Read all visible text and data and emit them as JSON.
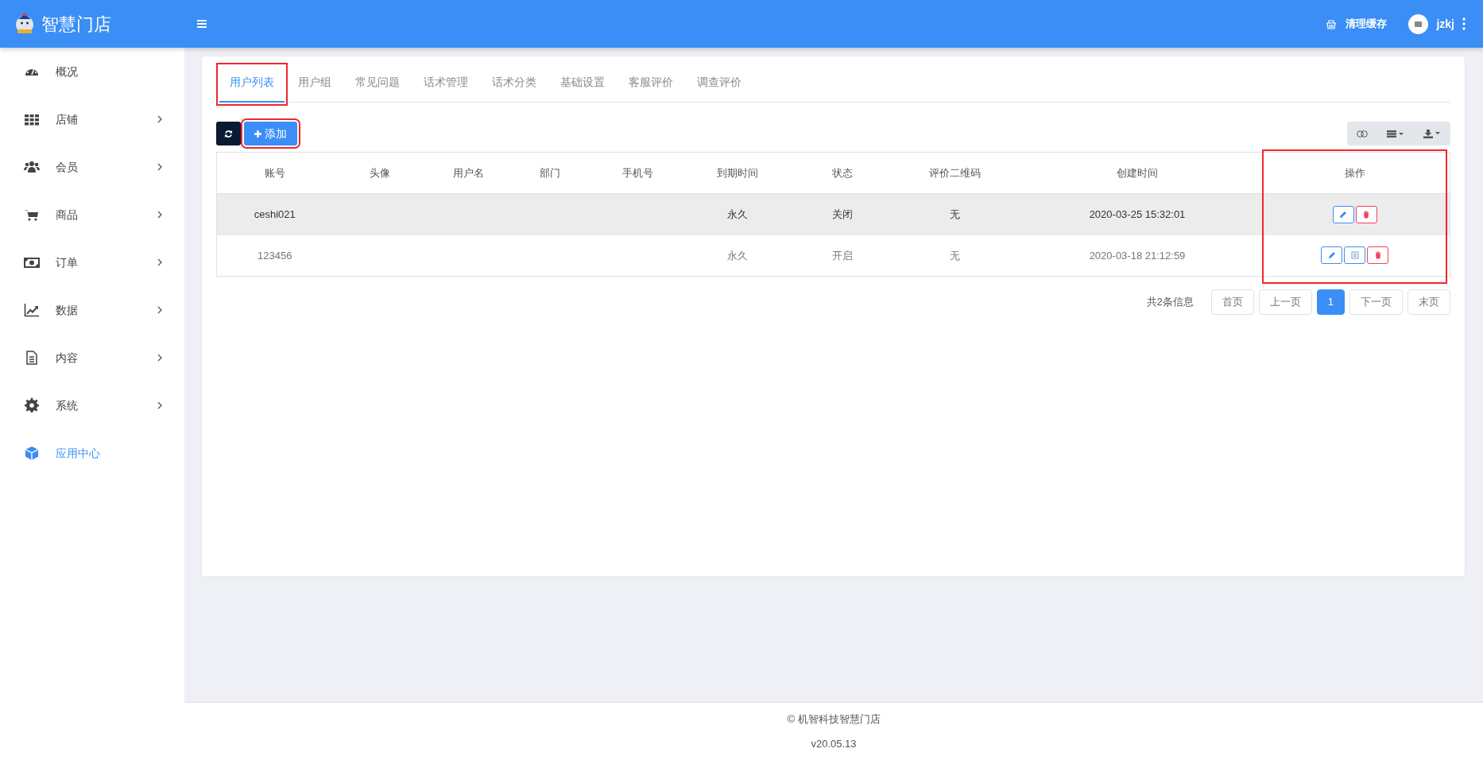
{
  "header": {
    "logo_text": "智慧门店",
    "clear_cache": "清理缓存",
    "username": "jzkj"
  },
  "sidebar": {
    "items": [
      {
        "label": "概况",
        "has_submenu": false,
        "selected": false
      },
      {
        "label": "店铺",
        "has_submenu": true,
        "selected": false
      },
      {
        "label": "会员",
        "has_submenu": true,
        "selected": false
      },
      {
        "label": "商品",
        "has_submenu": true,
        "selected": false
      },
      {
        "label": "订单",
        "has_submenu": true,
        "selected": false
      },
      {
        "label": "数据",
        "has_submenu": true,
        "selected": false
      },
      {
        "label": "内容",
        "has_submenu": true,
        "selected": false
      },
      {
        "label": "系统",
        "has_submenu": true,
        "selected": false
      },
      {
        "label": "应用中心",
        "has_submenu": false,
        "selected": true
      }
    ]
  },
  "tabs": [
    {
      "label": "用户列表",
      "selected": true,
      "highlighted": true
    },
    {
      "label": "用户组",
      "selected": false,
      "highlighted": false
    },
    {
      "label": "常见问题",
      "selected": false,
      "highlighted": false
    },
    {
      "label": "话术管理",
      "selected": false,
      "highlighted": false
    },
    {
      "label": "话术分类",
      "selected": false,
      "highlighted": false
    },
    {
      "label": "基础设置",
      "selected": false,
      "highlighted": false
    },
    {
      "label": "客服评价",
      "selected": false,
      "highlighted": false
    },
    {
      "label": "调查评价",
      "selected": false,
      "highlighted": false
    }
  ],
  "toolbar": {
    "add_label": "添加",
    "add_highlighted": true
  },
  "table": {
    "columns": [
      {
        "label": "账号",
        "highlighted": false
      },
      {
        "label": "头像",
        "highlighted": false
      },
      {
        "label": "用户名",
        "highlighted": false
      },
      {
        "label": "部门",
        "highlighted": false
      },
      {
        "label": "手机号",
        "highlighted": false
      },
      {
        "label": "到期时间",
        "highlighted": false
      },
      {
        "label": "状态",
        "highlighted": false
      },
      {
        "label": "评价二维码",
        "highlighted": false
      },
      {
        "label": "创建时间",
        "highlighted": false
      },
      {
        "label": "操作",
        "highlighted": true
      }
    ],
    "rows": [
      {
        "selected": true,
        "cells": [
          "ceshi021",
          "",
          "",
          "",
          "",
          "永久",
          "关闭",
          "无",
          "2020-03-25 15:32:01"
        ],
        "has_qr_button": false
      },
      {
        "selected": false,
        "cells": [
          "123456",
          "",
          "",
          "",
          "",
          "永久",
          "开启",
          "无",
          "2020-03-18 21:12:59"
        ],
        "has_qr_button": true
      }
    ]
  },
  "pagination": {
    "summary": "共2条信息",
    "pages": [
      {
        "label": "首页",
        "selected": false
      },
      {
        "label": "上一页",
        "selected": false
      },
      {
        "label": "1",
        "selected": true
      },
      {
        "label": "下一页",
        "selected": false
      },
      {
        "label": "末页",
        "selected": false
      }
    ]
  },
  "footer": {
    "copyright": "© 机智科技智慧门店",
    "version": "v20.05.13"
  }
}
